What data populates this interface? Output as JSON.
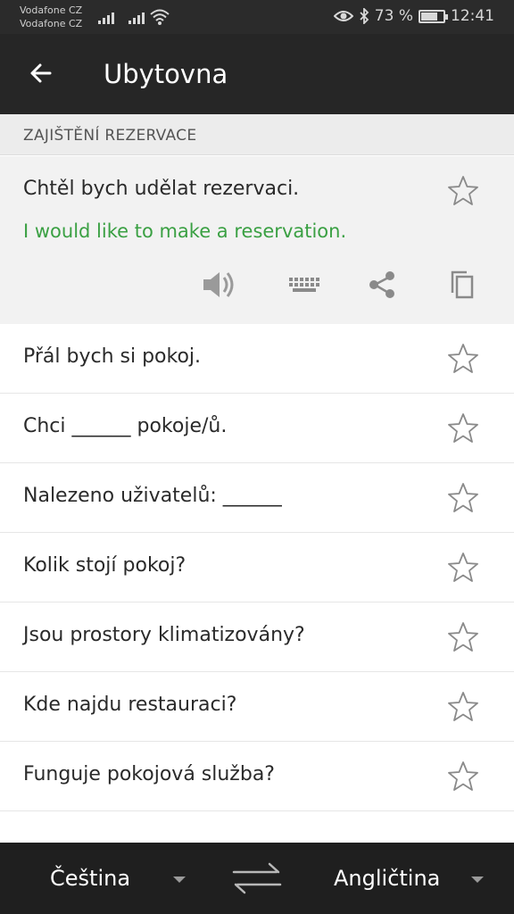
{
  "status_bar": {
    "carrier_1": "Vodafone CZ",
    "carrier_2": "Vodafone CZ",
    "battery": "73 %",
    "battery_level": 0.73,
    "time": "12:41",
    "icons": [
      "signal-icon",
      "wifi-icon",
      "eye-icon",
      "bluetooth-icon",
      "battery-icon"
    ]
  },
  "app_bar": {
    "title": "Ubytovna",
    "back_icon": "back-arrow-icon"
  },
  "section": {
    "label": "ZAJIŠTĚNÍ REZERVACE"
  },
  "expanded": {
    "phrase": "Chtěl bych udělat rezervaci.",
    "translation": "I would like to make a reservation.",
    "translation_color": "#3aa043",
    "actions": [
      "speaker-icon",
      "keyboard-icon",
      "share-icon",
      "copy-icon"
    ]
  },
  "phrases": [
    {
      "text": "Přál bych si pokoj."
    },
    {
      "text": "Chci ______ pokoje/ů."
    },
    {
      "text": "Nalezeno uživatelů: ______"
    },
    {
      "text": "Kolik stojí pokoj?"
    },
    {
      "text": "Jsou prostory klimatizovány?"
    },
    {
      "text": "Kde najdu restauraci?"
    },
    {
      "text": "Funguje pokojová služba?"
    }
  ],
  "bottom_bar": {
    "source_language": "Čeština",
    "target_language": "Angličtina",
    "swap_icon": "swap-arrows-icon"
  }
}
